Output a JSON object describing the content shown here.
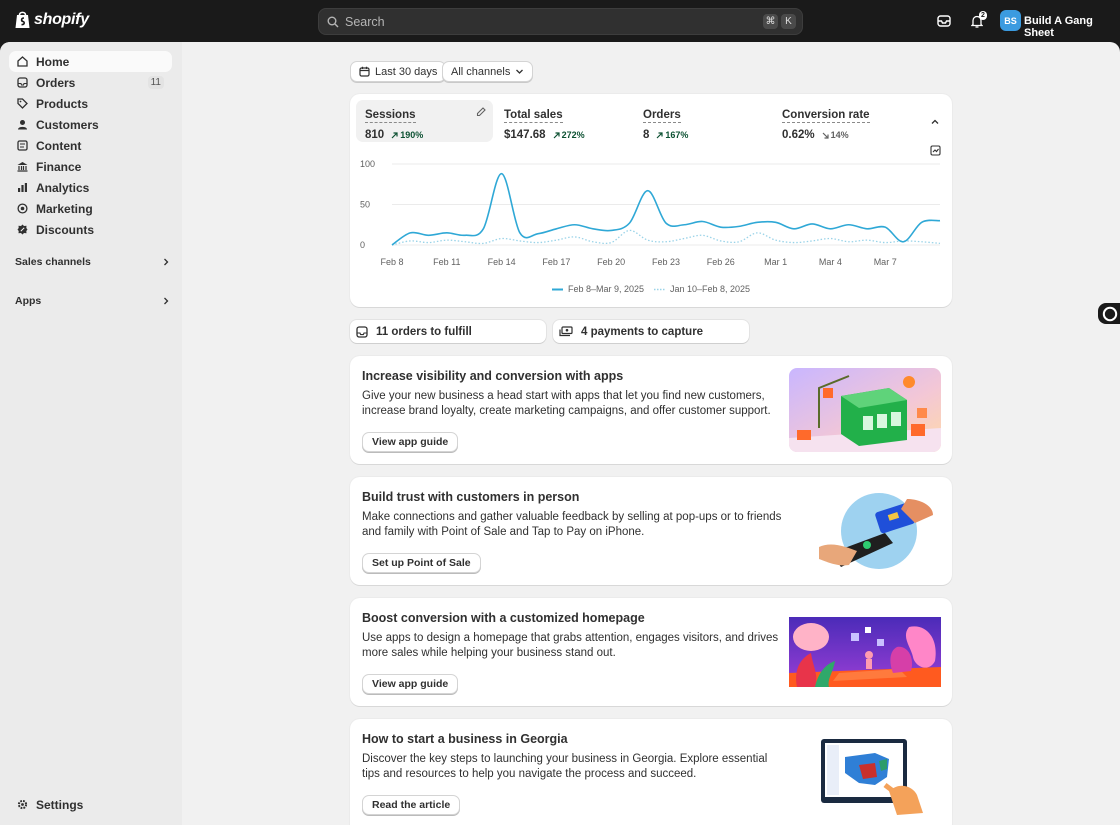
{
  "topbar": {
    "brand": "shopify",
    "search_placeholder": "Search",
    "shortcut_cmd": "⌘",
    "shortcut_key": "K",
    "notification_count": "2",
    "avatar_initials": "BS",
    "store_name": "Build A Gang Sheet"
  },
  "sidebar": {
    "items": [
      {
        "label": "Home",
        "icon": "home-icon"
      },
      {
        "label": "Orders",
        "icon": "orders-icon",
        "count": "11"
      },
      {
        "label": "Products",
        "icon": "tag-icon"
      },
      {
        "label": "Customers",
        "icon": "person-icon"
      },
      {
        "label": "Content",
        "icon": "content-icon"
      },
      {
        "label": "Finance",
        "icon": "bank-icon"
      },
      {
        "label": "Analytics",
        "icon": "chart-icon"
      },
      {
        "label": "Marketing",
        "icon": "target-icon"
      },
      {
        "label": "Discounts",
        "icon": "discount-icon"
      }
    ],
    "sales_channels": "Sales channels",
    "apps": "Apps",
    "settings": "Settings"
  },
  "filters": {
    "date_range": "Last 30 days",
    "channel": "All channels"
  },
  "metrics": [
    {
      "title": "Sessions",
      "value": "810",
      "change": "190%",
      "direction": "up"
    },
    {
      "title": "Total sales",
      "value": "$147.68",
      "change": "272%",
      "direction": "up"
    },
    {
      "title": "Orders",
      "value": "8",
      "change": "167%",
      "direction": "up"
    },
    {
      "title": "Conversion rate",
      "value": "0.62%",
      "change": "14%",
      "direction": "down"
    }
  ],
  "chart_data": {
    "type": "line",
    "title": "",
    "xlabel": "",
    "ylabel": "",
    "x_ticks": [
      "Feb 8",
      "Feb 11",
      "Feb 14",
      "Feb 17",
      "Feb 20",
      "Feb 23",
      "Feb 26",
      "Mar 1",
      "Mar 4",
      "Mar 7"
    ],
    "y_ticks": [
      "100",
      "50",
      "0"
    ],
    "ylim": [
      0,
      100
    ],
    "grid": true,
    "legend_position": "bottom-center",
    "series": [
      {
        "name": "Feb 8–Mar 9, 2025",
        "color": "#2fa8d6",
        "style": "solid",
        "values": [
          0,
          15,
          12,
          15,
          12,
          20,
          88,
          15,
          14,
          20,
          25,
          20,
          18,
          27,
          67,
          27,
          25,
          29,
          22,
          23,
          28,
          28,
          20,
          26,
          20,
          25,
          20,
          22,
          4,
          28,
          30
        ]
      },
      {
        "name": "Jan 10–Feb 8, 2025",
        "color": "#9ad3e8",
        "style": "dotted",
        "values": [
          0,
          5,
          3,
          6,
          4,
          2,
          8,
          5,
          3,
          6,
          10,
          4,
          3,
          18,
          6,
          4,
          8,
          12,
          5,
          4,
          15,
          6,
          3,
          5,
          8,
          4,
          6,
          3,
          5,
          4,
          2
        ]
      }
    ]
  },
  "tasks": [
    {
      "label": "11 orders to fulfill",
      "icon": "orders-icon"
    },
    {
      "label": "4 payments to capture",
      "icon": "cash-icon"
    }
  ],
  "promos": [
    {
      "title": "Increase visibility and conversion with apps",
      "text": "Give your new business a head start with apps that let you find new customers, increase brand loyalty, create marketing campaigns, and offer customer support.",
      "button": "View app guide",
      "illustration": "store-building-illustration"
    },
    {
      "title": "Build trust with customers in person",
      "text": "Make connections and gather valuable feedback by selling at pop-ups or to friends and family with Point of Sale and Tap to Pay on iPhone.",
      "button": "Set up Point of Sale",
      "illustration": "tap-to-pay-illustration"
    },
    {
      "title": "Boost conversion with a customized homepage",
      "text": "Use apps to design a homepage that grabs attention, engages visitors, and drives more sales while helping your business stand out.",
      "button": "View app guide",
      "illustration": "homepage-stage-illustration"
    },
    {
      "title": "How to start a business in Georgia",
      "text": "Discover the key steps to launching your business in Georgia. Explore essential tips and resources to help you navigate the process and succeed.",
      "button": "Read the article",
      "illustration": "map-screen-illustration"
    }
  ],
  "colors": {
    "accent": "#2fa8d6",
    "positive": "#0c5132",
    "topbar": "#1a1a1a"
  }
}
